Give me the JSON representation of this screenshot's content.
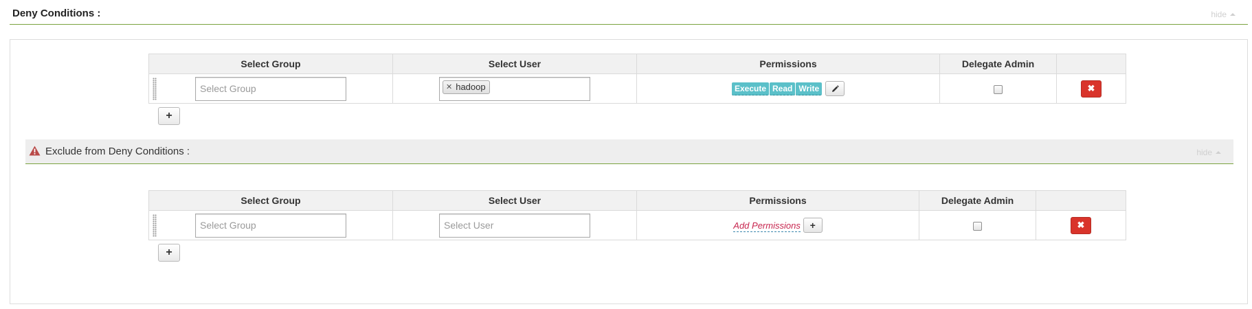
{
  "deny_section": {
    "title": "Deny Conditions :",
    "hide_label": "hide"
  },
  "deny_table": {
    "headers": [
      "Select Group",
      "Select User",
      "Permissions",
      "Delegate Admin",
      ""
    ],
    "row": {
      "group_placeholder": "Select Group",
      "user_chips": [
        "hadoop"
      ],
      "permissions": [
        "Execute",
        "Read",
        "Write"
      ],
      "delegate_admin_checked": false
    }
  },
  "exclude_section": {
    "title": "Exclude from Deny Conditions :",
    "hide_label": "hide"
  },
  "exclude_table": {
    "headers": [
      "Select Group",
      "Select User",
      "Permissions",
      "Delegate Admin",
      ""
    ],
    "row": {
      "group_placeholder": "Select Group",
      "user_placeholder": "Select User",
      "add_permissions_label": "Add Permissions",
      "delegate_admin_checked": false
    }
  },
  "colors": {
    "accent_line": "#7aa33e",
    "permission_tag": "#5bc0c9",
    "delete_button": "#d9342b",
    "warning_icon": "#b94a48"
  },
  "icons": {
    "hide_caret": "caret-up-icon",
    "remove_chip": "close-icon",
    "edit": "pencil-icon",
    "add": "plus-icon",
    "delete": "close-icon",
    "warning": "warning-triangle-icon"
  }
}
